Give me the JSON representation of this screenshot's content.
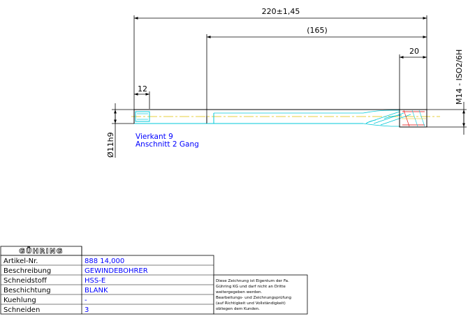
{
  "dimensions": {
    "overall_length": "220±1,45",
    "flute_length": "(165)",
    "thread_end": "20",
    "square_length": "12",
    "thread_spec": "M14 - ISO2/6H",
    "shank_diameter": "Ø11h9"
  },
  "notes": {
    "line1": "Vierkant 9",
    "line2": "Anschnitt 2 Gang"
  },
  "title_block": {
    "logo": "GÜHRING",
    "rows": [
      {
        "label": "Artikel-Nr.",
        "value": "888 14,000"
      },
      {
        "label": "Beschreibung",
        "value": "GEWINDEBOHRER"
      },
      {
        "label": "Schneidstoff",
        "value": "HSS-E"
      },
      {
        "label": "Beschichtung",
        "value": "BLANK"
      },
      {
        "label": "Kuehlung",
        "value": "-"
      },
      {
        "label": "Schneiden",
        "value": "3"
      }
    ]
  },
  "legal_lines": [
    "Diese Zeichnung ist Eigentum der Fa.",
    "Gühring KG und darf nicht an Dritte",
    "weitergegeben werden.",
    "Bearbeitungs- und Zeichnungsprüfung",
    "(auf Richtigkeit und Vollständigkeit)",
    "obliegen dem Kunden."
  ],
  "colors": {
    "dimension_lines": "#000000",
    "outline": "#000000",
    "hidden_lines": "#00c8d8",
    "centerline": "#e0c000",
    "thread": "#e00000",
    "note_text": "#0000ff",
    "table_values": "#0000ff"
  }
}
